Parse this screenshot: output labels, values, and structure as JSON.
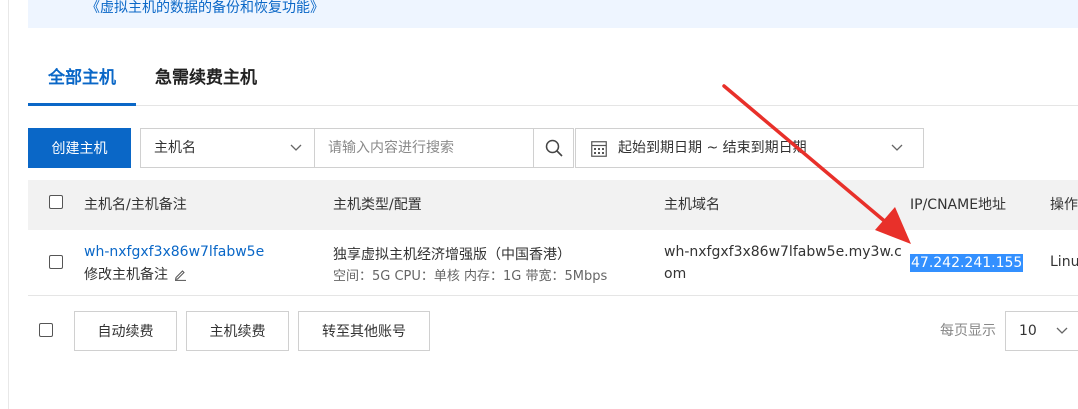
{
  "notice": {
    "link_text": "《虚拟主机的数据的备份和恢复功能》"
  },
  "tabs": [
    {
      "label": "全部主机",
      "active": true
    },
    {
      "label": "急需续费主机",
      "active": false
    }
  ],
  "toolbar": {
    "create_label": "创建主机",
    "filter_select": "主机名",
    "search_placeholder": "请输入内容进行搜索",
    "date_range": "起始到期日期 ~ 结束到期日期"
  },
  "table": {
    "headers": {
      "name": "主机名/主机备注",
      "type": "主机类型/配置",
      "domain": "主机域名",
      "ip": "IP/CNAME地址",
      "action": "操作"
    },
    "rows": [
      {
        "host_name": "wh-nxfgxf3x86w7lfabw5e",
        "remark_label": "修改主机备注",
        "type": "独享虚拟主机经济增强版（中国香港）",
        "config": "空间：5G CPU：单核 内存：1G 带宽：5Mbps",
        "domain_line1": "wh-nxfgxf3x86w7lfabw5e.my3w.c",
        "domain_line2": "om",
        "ip": "47.242.241.155",
        "os": "Linux"
      }
    ]
  },
  "footer": {
    "auto_renew_label": "自动续费",
    "host_renew_label": "主机续费",
    "transfer_label": "转至其他账号",
    "per_page_label": "每页显示",
    "per_page_value": "10"
  },
  "colors": {
    "accent": "#0a67c7",
    "selection": "#3390ff",
    "annotation_arrow": "#e8302a",
    "notice_bg": "#eef5ff",
    "header_bg": "#f2f2f2"
  },
  "icons": [
    "chevron-down-icon",
    "search-icon",
    "calendar-icon",
    "edit-icon",
    "checkbox"
  ]
}
